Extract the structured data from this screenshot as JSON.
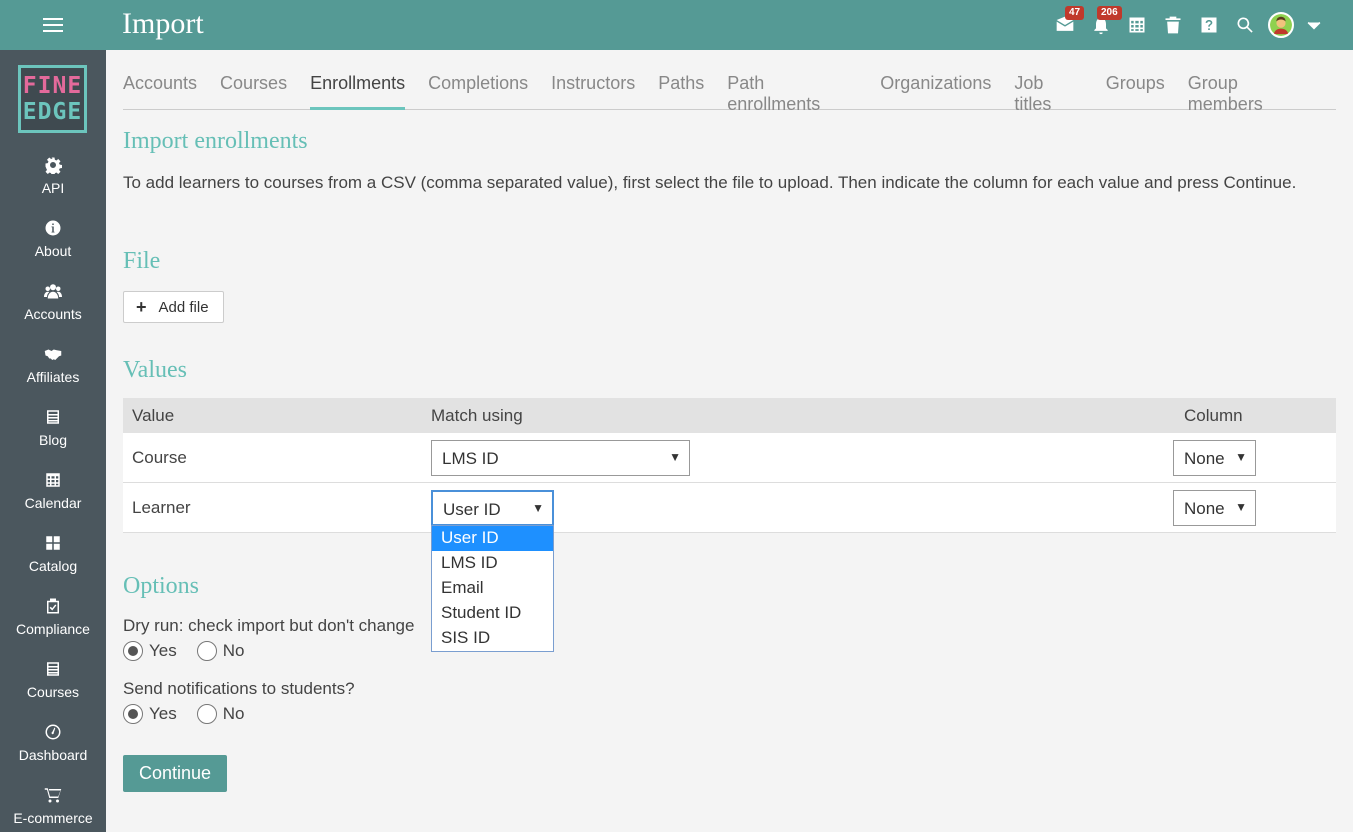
{
  "app": {
    "title": "Import",
    "notifications": {
      "messages_count": "47",
      "alerts_count": "206"
    }
  },
  "logo": {
    "line1": "FINE",
    "line2": "EDGE"
  },
  "sidebar": {
    "items": [
      {
        "label": "API",
        "icon": "gear-icon"
      },
      {
        "label": "About",
        "icon": "info-icon"
      },
      {
        "label": "Accounts",
        "icon": "users-icon"
      },
      {
        "label": "Affiliates",
        "icon": "handshake-icon"
      },
      {
        "label": "Blog",
        "icon": "blog-icon"
      },
      {
        "label": "Calendar",
        "icon": "calendar-icon"
      },
      {
        "label": "Catalog",
        "icon": "grid-icon"
      },
      {
        "label": "Compliance",
        "icon": "clipboard-check-icon"
      },
      {
        "label": "Courses",
        "icon": "book-icon"
      },
      {
        "label": "Dashboard",
        "icon": "dashboard-icon"
      },
      {
        "label": "E-commerce",
        "icon": "cart-icon"
      }
    ]
  },
  "tabs": [
    {
      "label": "Accounts"
    },
    {
      "label": "Courses"
    },
    {
      "label": "Enrollments",
      "active": true
    },
    {
      "label": "Completions"
    },
    {
      "label": "Instructors"
    },
    {
      "label": "Paths"
    },
    {
      "label": "Path enrollments"
    },
    {
      "label": "Organizations"
    },
    {
      "label": "Job titles"
    },
    {
      "label": "Groups"
    },
    {
      "label": "Group members"
    }
  ],
  "main": {
    "heading": "Import enrollments",
    "description": "To add learners to courses from a CSV (comma separated value), first select the file to upload. Then indicate the column for each value and press Continue.",
    "file_heading": "File",
    "add_file_label": "Add file",
    "values_heading": "Values",
    "table": {
      "headers": {
        "value": "Value",
        "match": "Match using",
        "column": "Column"
      },
      "rows": [
        {
          "name": "Course",
          "match": "LMS ID",
          "column": "None"
        },
        {
          "name": "Learner",
          "match": "User ID",
          "column": "None"
        }
      ]
    },
    "dropdown_options": [
      "User ID",
      "LMS ID",
      "Email",
      "Student ID",
      "SIS ID"
    ],
    "options_heading": "Options",
    "dry_run_label": "Dry run: check import but don't change",
    "notify_label": "Send notifications to students?",
    "yes_label": "Yes",
    "no_label": "No",
    "continue_label": "Continue"
  },
  "colors": {
    "brand": "#559a95",
    "accent": "#66bfb6",
    "sidebar": "#4b575e",
    "badge": "#c0392b"
  }
}
